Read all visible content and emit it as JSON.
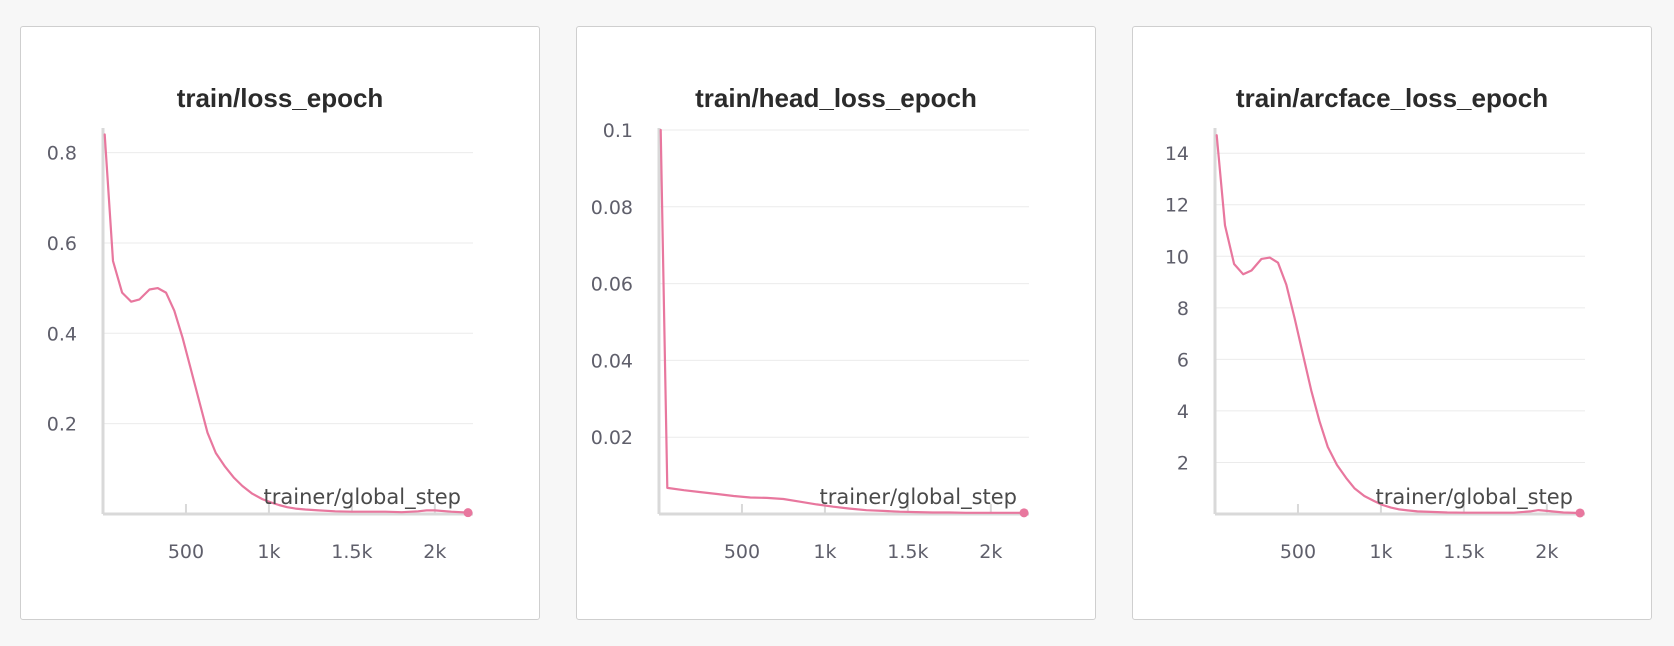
{
  "colors": {
    "line": "#e8779e",
    "grid": "#ebebeb",
    "axis": "#d9d9d9",
    "text": "#5f5f6b",
    "title": "#2b2b2b"
  },
  "chart_data": [
    {
      "type": "line",
      "title": "train/loss_epoch",
      "xlabel": "trainer/global_step",
      "ylabel": "",
      "xlim": [
        0,
        2230
      ],
      "ylim": [
        0,
        0.85
      ],
      "xticks": [
        500,
        1000,
        1500,
        2000
      ],
      "xtick_labels": [
        "500",
        "1k",
        "1.5k",
        "2k"
      ],
      "yticks": [
        0.2,
        0.4,
        0.6,
        0.8
      ],
      "ytick_labels": [
        "0.2",
        "0.4",
        "0.6",
        "0.8"
      ],
      "grid": true,
      "series": [
        {
          "x": [
            10,
            60,
            115,
            170,
            220,
            280,
            330,
            380,
            430,
            480,
            530,
            580,
            630,
            680,
            735,
            790,
            840,
            900,
            960,
            1010,
            1060,
            1110,
            1160,
            1220,
            1300,
            1400,
            1500,
            1600,
            1700,
            1800,
            1900,
            1950,
            2000,
            2100,
            2200
          ],
          "y": [
            0.84,
            0.56,
            0.49,
            0.47,
            0.475,
            0.497,
            0.5,
            0.49,
            0.45,
            0.39,
            0.32,
            0.25,
            0.18,
            0.135,
            0.105,
            0.08,
            0.062,
            0.045,
            0.033,
            0.026,
            0.02,
            0.015,
            0.012,
            0.01,
            0.008,
            0.006,
            0.005,
            0.005,
            0.005,
            0.004,
            0.006,
            0.008,
            0.008,
            0.005,
            0.003
          ]
        }
      ]
    },
    {
      "type": "line",
      "title": "train/head_loss_epoch",
      "xlabel": "trainer/global_step",
      "ylabel": "",
      "xlim": [
        0,
        2230
      ],
      "ylim": [
        0,
        0.1
      ],
      "xticks": [
        500,
        1000,
        1500,
        2000
      ],
      "xtick_labels": [
        "500",
        "1k",
        "1.5k",
        "2k"
      ],
      "yticks": [
        0.02,
        0.04,
        0.06,
        0.08,
        0.1
      ],
      "ytick_labels": [
        "0.02",
        "0.04",
        "0.06",
        "0.08",
        "0.1"
      ],
      "grid": true,
      "series": [
        {
          "x": [
            10,
            50,
            150,
            250,
            350,
            450,
            550,
            650,
            750,
            850,
            950,
            1050,
            1150,
            1250,
            1350,
            1450,
            1550,
            1650,
            1750,
            1850,
            1950,
            2050,
            2200
          ],
          "y": [
            0.1,
            0.0068,
            0.0062,
            0.0057,
            0.0052,
            0.0047,
            0.0043,
            0.0042,
            0.0039,
            0.0032,
            0.0025,
            0.0019,
            0.0014,
            0.001,
            0.0008,
            0.0006,
            0.0005,
            0.0004,
            0.0004,
            0.0003,
            0.0003,
            0.0003,
            0.0003
          ]
        }
      ]
    },
    {
      "type": "line",
      "title": "train/arcface_loss_epoch",
      "xlabel": "trainer/global_step",
      "ylabel": "",
      "xlim": [
        0,
        2230
      ],
      "ylim": [
        0,
        14.9
      ],
      "xticks": [
        500,
        1000,
        1500,
        2000
      ],
      "xtick_labels": [
        "500",
        "1k",
        "1.5k",
        "2k"
      ],
      "yticks": [
        2,
        4,
        6,
        8,
        10,
        12,
        14
      ],
      "ytick_labels": [
        "2",
        "4",
        "6",
        "8",
        "10",
        "12",
        "14"
      ],
      "grid": true,
      "series": [
        {
          "x": [
            10,
            60,
            115,
            170,
            220,
            280,
            330,
            380,
            430,
            480,
            530,
            580,
            630,
            680,
            735,
            790,
            840,
            900,
            960,
            1010,
            1060,
            1110,
            1160,
            1220,
            1300,
            1400,
            1500,
            1600,
            1700,
            1800,
            1900,
            1950,
            2000,
            2100,
            2200
          ],
          "y": [
            14.7,
            11.2,
            9.7,
            9.3,
            9.45,
            9.9,
            9.95,
            9.75,
            8.9,
            7.6,
            6.2,
            4.8,
            3.6,
            2.6,
            1.9,
            1.4,
            1.0,
            0.7,
            0.5,
            0.35,
            0.25,
            0.18,
            0.14,
            0.1,
            0.08,
            0.06,
            0.05,
            0.05,
            0.05,
            0.05,
            0.1,
            0.15,
            0.12,
            0.06,
            0.04
          ]
        }
      ]
    }
  ]
}
